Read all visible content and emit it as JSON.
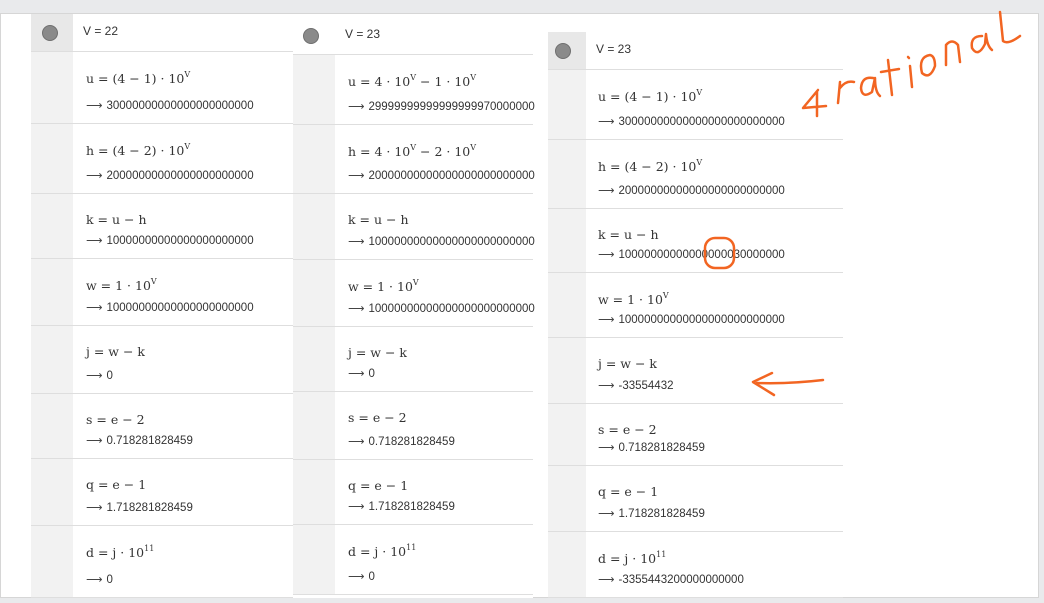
{
  "colors": {
    "ink": "#f26522",
    "toggle": "#8a8a8a",
    "gutter": "#f2f2f2"
  },
  "panels": [
    {
      "header": "V = 22",
      "rows": [
        {
          "def": "u = (4 − 1) · 10",
          "exp": "V",
          "result": "30000000000000000000000"
        },
        {
          "def": "h = (4 − 2) · 10",
          "exp": "V",
          "result": "20000000000000000000000"
        },
        {
          "def": "k = u − h",
          "exp": "",
          "result": "10000000000000000000000"
        },
        {
          "def": "w = 1 · 10",
          "exp": "V",
          "result": "10000000000000000000000"
        },
        {
          "def": "j = w − k",
          "exp": "",
          "result": "0"
        },
        {
          "def": "s = e − 2",
          "exp": "",
          "result": "0.718281828459"
        },
        {
          "def": "q = e − 1",
          "exp": "",
          "result": "1.718281828459"
        },
        {
          "def": "d = j · 10",
          "exp": "11",
          "result": "0"
        }
      ]
    },
    {
      "header": "V = 23",
      "rows": [
        {
          "def": "u = 4 · 10",
          "exp": "V",
          "tail": " − 1 · 10",
          "exp2": "V",
          "result": "29999999999999999970000000"
        },
        {
          "def": "h = 4 · 10",
          "exp": "V",
          "tail": " − 2 · 10",
          "exp2": "V",
          "result": "20000000000000000000000000"
        },
        {
          "def": "k = u − h",
          "exp": "",
          "result": "10000000000000000000000000"
        },
        {
          "def": "w = 1 · 10",
          "exp": "V",
          "result": "10000000000000000000000000"
        },
        {
          "def": "j = w − k",
          "exp": "",
          "result": "0"
        },
        {
          "def": "s = e − 2",
          "exp": "",
          "result": "0.718281828459"
        },
        {
          "def": "q = e − 1",
          "exp": "",
          "result": "1.718281828459"
        },
        {
          "def": "d = j · 10",
          "exp": "11",
          "result": "0"
        }
      ]
    },
    {
      "header": "V = 23",
      "rows": [
        {
          "def": "u = (4 − 1) · 10",
          "exp": "V",
          "result": "30000000000000000000000000"
        },
        {
          "def": "h = (4 − 2) · 10",
          "exp": "V",
          "result": "20000000000000000000000000"
        },
        {
          "def": "k = u − h",
          "exp": "",
          "result": "10000000000000000030000000"
        },
        {
          "def": "w = 1 · 10",
          "exp": "V",
          "result": "10000000000000000000000000"
        },
        {
          "def": "j = w − k",
          "exp": "",
          "result": "-33554432"
        },
        {
          "def": "s = e − 2",
          "exp": "",
          "result": "0.718281828459"
        },
        {
          "def": "q = e − 1",
          "exp": "",
          "result": "1.718281828459"
        },
        {
          "def": "d = j · 10",
          "exp": "11",
          "result": "-3355443200000000000"
        }
      ]
    }
  ],
  "annotation": {
    "text": "4 rational"
  },
  "arrow_glyph": "⟶"
}
